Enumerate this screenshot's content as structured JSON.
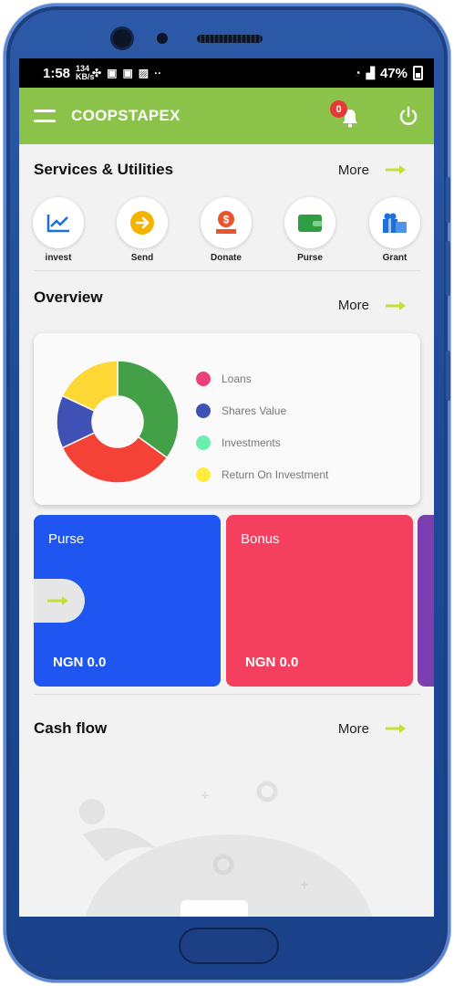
{
  "status_bar": {
    "time": "1:58",
    "net_speed": "134 KB/s",
    "battery": "47%"
  },
  "app_bar": {
    "title": "COOPSTAPEX",
    "notification_count": "0",
    "icons": [
      "menu-icon",
      "bell-icon",
      "power-icon"
    ],
    "color": "#8bc34a"
  },
  "services": {
    "title": "Services & Utilities",
    "more_label": "More",
    "items": [
      {
        "label": "invest",
        "icon": "chart-line-icon",
        "color": "#1e6fd9"
      },
      {
        "label": "Send",
        "icon": "arrow-circle-icon",
        "color": "#f5b301"
      },
      {
        "label": "Donate",
        "icon": "donate-hand-icon",
        "color": "#e8542c"
      },
      {
        "label": "Purse",
        "icon": "wallet-icon",
        "color": "#2e9e44"
      },
      {
        "label": "Grant",
        "icon": "gift-icon",
        "color": "#1e6fd9"
      }
    ]
  },
  "overview": {
    "title": "Overview",
    "more_label": "More",
    "legend": [
      {
        "label": "Loans",
        "color": "#ec407a"
      },
      {
        "label": "Shares Value",
        "color": "#3f51b5"
      },
      {
        "label": "Investments",
        "color": "#69f0ae"
      },
      {
        "label": "Return On Investment",
        "color": "#ffeb3b"
      }
    ],
    "chart_data": {
      "type": "pie",
      "title": "",
      "series": [
        {
          "values": [
            35,
            33,
            14,
            18
          ],
          "colors": [
            "#43a047",
            "#f44336",
            "#3f51b5",
            "#fdd835"
          ]
        }
      ]
    }
  },
  "wallets": [
    {
      "title": "Purse",
      "amount": "NGN 0.0",
      "color": "#1f55f0"
    },
    {
      "title": "Bonus",
      "amount": "NGN 0.0",
      "color": "#f43f5e"
    }
  ],
  "cash_flow": {
    "title": "Cash flow",
    "more_label": "More"
  },
  "accent_arrow_color": "#c6de3a"
}
